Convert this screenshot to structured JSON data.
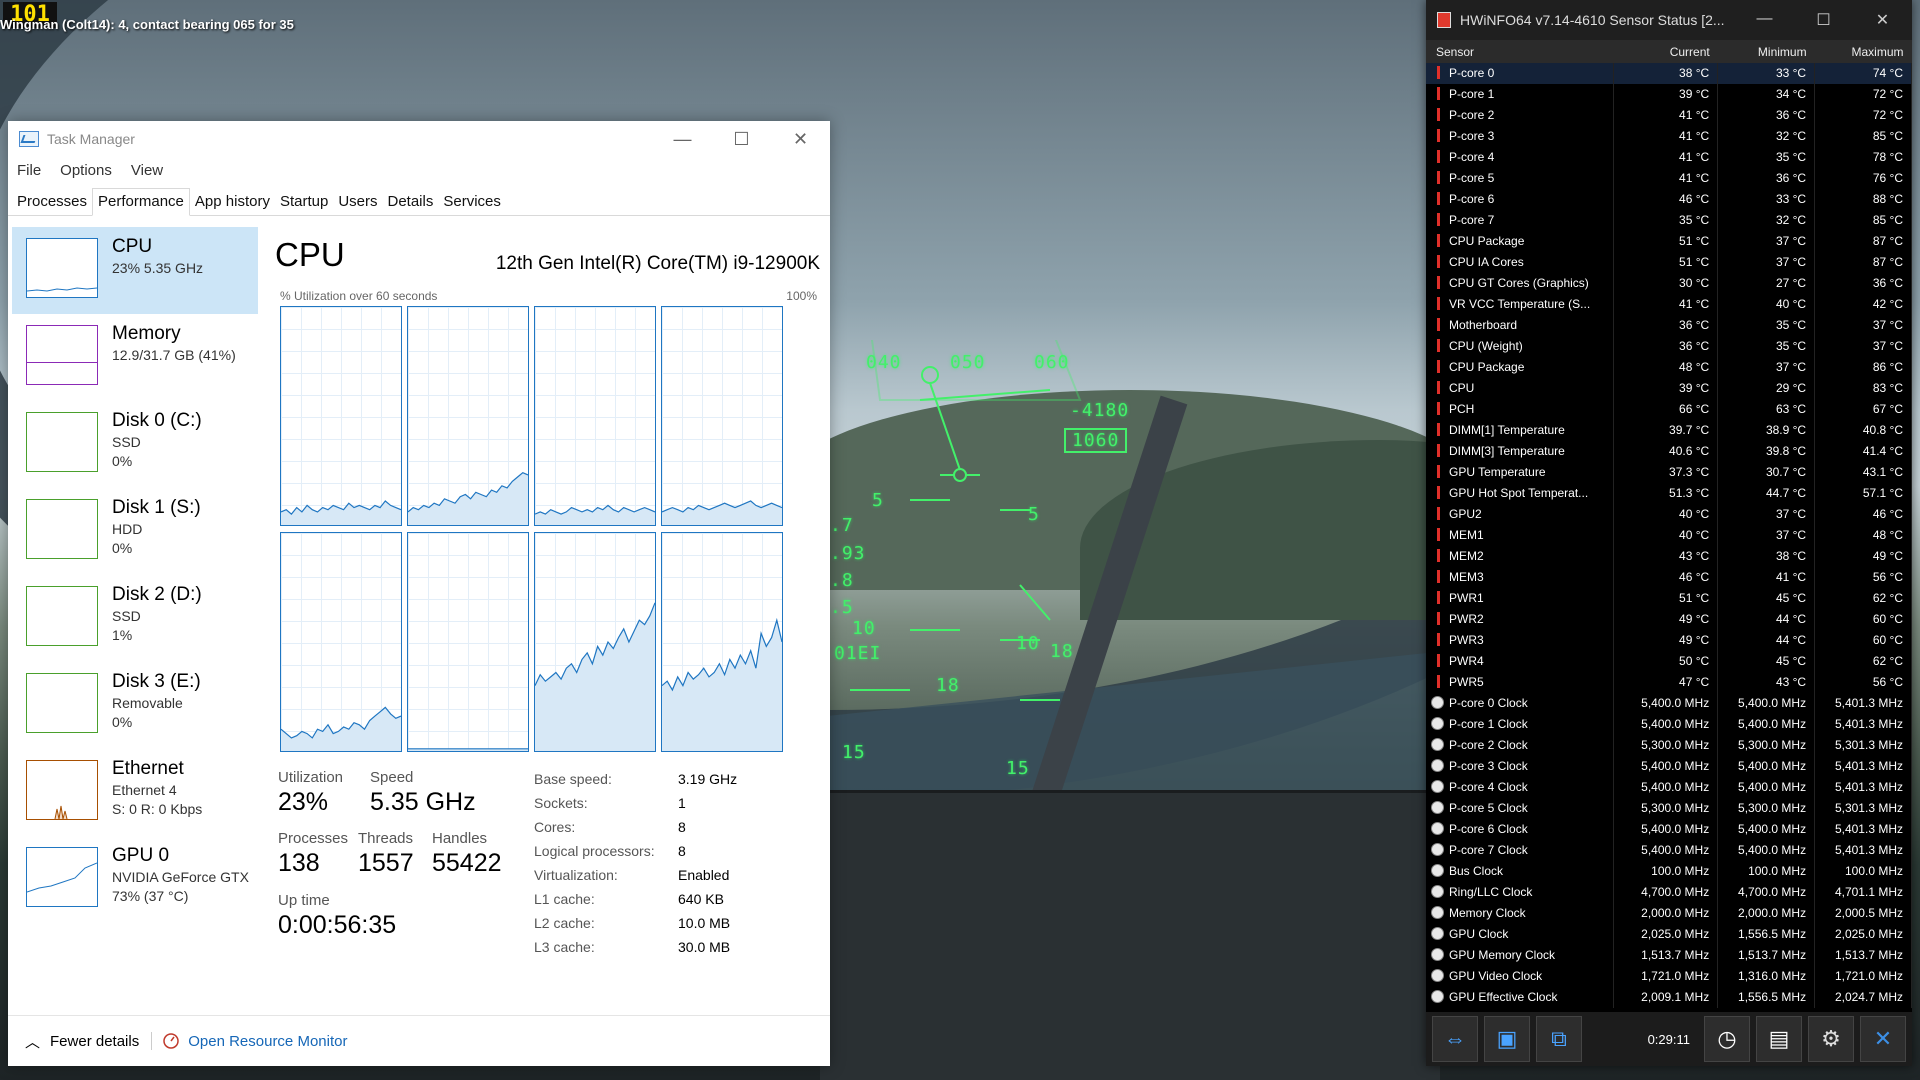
{
  "game": {
    "logo_text": "101",
    "status_line": "Wingman (Colt14): 4, contact bearing 065 for 35",
    "hud_labels": [
      "040",
      "050",
      "060",
      "-4180",
      "1060",
      "5",
      "5",
      ".7",
      ".93",
      ".8",
      ".5",
      "10",
      "10",
      "18",
      "18",
      "15",
      "15",
      "01EI"
    ]
  },
  "taskmanager": {
    "title": "Task Manager",
    "window_buttons": [
      "—",
      "☐",
      "✕"
    ],
    "menu": [
      "File",
      "Options",
      "View"
    ],
    "tabs": [
      "Processes",
      "Performance",
      "App history",
      "Startup",
      "Users",
      "Details",
      "Services"
    ],
    "active_tab": "Performance",
    "sidebar": [
      {
        "name": "CPU",
        "sub1": "23%  5.35 GHz",
        "sub2": ""
      },
      {
        "name": "Memory",
        "sub1": "12.9/31.7 GB (41%)",
        "sub2": ""
      },
      {
        "name": "Disk 0 (C:)",
        "sub1": "SSD",
        "sub2": "0%"
      },
      {
        "name": "Disk 1 (S:)",
        "sub1": "HDD",
        "sub2": "0%"
      },
      {
        "name": "Disk 2 (D:)",
        "sub1": "SSD",
        "sub2": "1%"
      },
      {
        "name": "Disk 3 (E:)",
        "sub1": "Removable",
        "sub2": "0%"
      },
      {
        "name": "Ethernet",
        "sub1": "Ethernet 4",
        "sub2": "S: 0 R: 0 Kbps"
      },
      {
        "name": "GPU 0",
        "sub1": "NVIDIA GeForce GTX",
        "sub2": "73% (37 °C)"
      }
    ],
    "cpu": {
      "heading": "CPU",
      "model": "12th Gen Intel(R) Core(TM) i9-12900K",
      "util_label": "% Utilization over 60 seconds",
      "util_max": "100%",
      "core_utilization": [
        [
          6,
          7,
          5,
          8,
          6,
          9,
          7,
          6,
          8,
          7,
          9,
          8,
          7,
          10,
          8,
          9,
          8,
          7,
          9,
          8,
          11,
          9,
          8,
          7
        ],
        [
          6,
          8,
          7,
          9,
          8,
          10,
          9,
          12,
          11,
          10,
          13,
          14,
          12,
          15,
          14,
          13,
          16,
          15,
          18,
          17,
          20,
          22,
          24,
          23
        ],
        [
          5,
          6,
          5,
          7,
          6,
          5,
          6,
          8,
          7,
          6,
          7,
          6,
          8,
          7,
          9,
          7,
          6,
          8,
          7,
          6,
          7,
          8,
          7,
          6
        ],
        [
          6,
          7,
          8,
          7,
          6,
          8,
          7,
          9,
          8,
          7,
          8,
          9,
          10,
          9,
          8,
          9,
          10,
          11,
          9,
          8,
          9,
          10,
          9,
          8
        ],
        [
          10,
          8,
          6,
          7,
          9,
          8,
          6,
          10,
          9,
          12,
          8,
          9,
          11,
          10,
          13,
          12,
          10,
          14,
          16,
          18,
          20,
          17,
          15,
          16
        ],
        [
          1,
          1,
          1,
          1,
          1,
          1,
          1,
          1,
          1,
          1,
          1,
          1,
          1,
          1,
          1,
          1,
          1,
          1,
          1,
          1,
          1,
          1,
          1,
          1
        ],
        [
          30,
          35,
          32,
          34,
          36,
          33,
          38,
          40,
          36,
          42,
          45,
          40,
          48,
          44,
          50,
          47,
          52,
          56,
          50,
          55,
          60,
          58,
          62,
          68
        ],
        [
          30,
          32,
          28,
          34,
          30,
          36,
          33,
          35,
          38,
          34,
          36,
          40,
          35,
          42,
          38,
          44,
          40,
          46,
          38,
          54,
          48,
          52,
          60,
          50
        ]
      ],
      "stats": {
        "utilization_label": "Utilization",
        "utilization": "23%",
        "speed_label": "Speed",
        "speed": "5.35 GHz",
        "processes_label": "Processes",
        "processes": "138",
        "threads_label": "Threads",
        "threads": "1557",
        "handles_label": "Handles",
        "handles": "55422",
        "uptime_label": "Up time",
        "uptime": "0:00:56:35"
      },
      "details": [
        {
          "k": "Base speed:",
          "v": "3.19 GHz"
        },
        {
          "k": "Sockets:",
          "v": "1"
        },
        {
          "k": "Cores:",
          "v": "8"
        },
        {
          "k": "Logical processors:",
          "v": "8"
        },
        {
          "k": "Virtualization:",
          "v": "Enabled"
        },
        {
          "k": "L1 cache:",
          "v": "640 KB"
        },
        {
          "k": "L2 cache:",
          "v": "10.0 MB"
        },
        {
          "k": "L3 cache:",
          "v": "30.0 MB"
        }
      ]
    },
    "footer": {
      "fewer": "Fewer details",
      "resource_monitor": "Open Resource Monitor"
    }
  },
  "hwinfo": {
    "title": "HWiNFO64 v7.14-4610 Sensor Status [2...",
    "window_buttons": [
      "—",
      "☐",
      "✕"
    ],
    "columns": [
      "Sensor",
      "Current",
      "Minimum",
      "Maximum"
    ],
    "rows": [
      [
        "P-core 0",
        "38 °C",
        "33 °C",
        "74 °C",
        "t"
      ],
      [
        "P-core 1",
        "39 °C",
        "34 °C",
        "72 °C",
        "t"
      ],
      [
        "P-core 2",
        "41 °C",
        "36 °C",
        "72 °C",
        "t"
      ],
      [
        "P-core 3",
        "41 °C",
        "32 °C",
        "85 °C",
        "t"
      ],
      [
        "P-core 4",
        "41 °C",
        "35 °C",
        "78 °C",
        "t"
      ],
      [
        "P-core 5",
        "41 °C",
        "36 °C",
        "76 °C",
        "t"
      ],
      [
        "P-core 6",
        "46 °C",
        "33 °C",
        "88 °C",
        "t"
      ],
      [
        "P-core 7",
        "35 °C",
        "32 °C",
        "85 °C",
        "t"
      ],
      [
        "CPU Package",
        "51 °C",
        "37 °C",
        "87 °C",
        "t"
      ],
      [
        "CPU IA Cores",
        "51 °C",
        "37 °C",
        "87 °C",
        "t"
      ],
      [
        "CPU GT Cores (Graphics)",
        "30 °C",
        "27 °C",
        "36 °C",
        "t"
      ],
      [
        "VR VCC Temperature (S...",
        "41 °C",
        "40 °C",
        "42 °C",
        "t"
      ],
      [
        "Motherboard",
        "36 °C",
        "35 °C",
        "37 °C",
        "t"
      ],
      [
        "CPU (Weight)",
        "36 °C",
        "35 °C",
        "37 °C",
        "t"
      ],
      [
        "CPU Package",
        "48 °C",
        "37 °C",
        "86 °C",
        "t"
      ],
      [
        "CPU",
        "39 °C",
        "29 °C",
        "83 °C",
        "t"
      ],
      [
        "PCH",
        "66 °C",
        "63 °C",
        "67 °C",
        "t"
      ],
      [
        "DIMM[1] Temperature",
        "39.7 °C",
        "38.9 °C",
        "40.8 °C",
        "t"
      ],
      [
        "DIMM[3] Temperature",
        "40.6 °C",
        "39.8 °C",
        "41.4 °C",
        "t"
      ],
      [
        "GPU Temperature",
        "37.3 °C",
        "30.7 °C",
        "43.1 °C",
        "t"
      ],
      [
        "GPU Hot Spot Temperat...",
        "51.3 °C",
        "44.7 °C",
        "57.1 °C",
        "t"
      ],
      [
        "GPU2",
        "40 °C",
        "37 °C",
        "46 °C",
        "t"
      ],
      [
        "MEM1",
        "40 °C",
        "37 °C",
        "48 °C",
        "t"
      ],
      [
        "MEM2",
        "43 °C",
        "38 °C",
        "49 °C",
        "t"
      ],
      [
        "MEM3",
        "46 °C",
        "41 °C",
        "56 °C",
        "t"
      ],
      [
        "PWR1",
        "51 °C",
        "45 °C",
        "62 °C",
        "t"
      ],
      [
        "PWR2",
        "49 °C",
        "44 °C",
        "60 °C",
        "t"
      ],
      [
        "PWR3",
        "49 °C",
        "44 °C",
        "60 °C",
        "t"
      ],
      [
        "PWR4",
        "50 °C",
        "45 °C",
        "62 °C",
        "t"
      ],
      [
        "PWR5",
        "47 °C",
        "43 °C",
        "56 °C",
        "t"
      ],
      [
        "P-core 0 Clock",
        "5,400.0 MHz",
        "5,400.0 MHz",
        "5,401.3 MHz",
        "c"
      ],
      [
        "P-core 1 Clock",
        "5,400.0 MHz",
        "5,400.0 MHz",
        "5,401.3 MHz",
        "c"
      ],
      [
        "P-core 2 Clock",
        "5,300.0 MHz",
        "5,300.0 MHz",
        "5,301.3 MHz",
        "c"
      ],
      [
        "P-core 3 Clock",
        "5,400.0 MHz",
        "5,400.0 MHz",
        "5,401.3 MHz",
        "c"
      ],
      [
        "P-core 4 Clock",
        "5,400.0 MHz",
        "5,400.0 MHz",
        "5,401.3 MHz",
        "c"
      ],
      [
        "P-core 5 Clock",
        "5,300.0 MHz",
        "5,300.0 MHz",
        "5,301.3 MHz",
        "c"
      ],
      [
        "P-core 6 Clock",
        "5,400.0 MHz",
        "5,400.0 MHz",
        "5,401.3 MHz",
        "c"
      ],
      [
        "P-core 7 Clock",
        "5,400.0 MHz",
        "5,400.0 MHz",
        "5,401.3 MHz",
        "c"
      ],
      [
        "Bus Clock",
        "100.0 MHz",
        "100.0 MHz",
        "100.0 MHz",
        "c"
      ],
      [
        "Ring/LLC Clock",
        "4,700.0 MHz",
        "4,700.0 MHz",
        "4,701.1 MHz",
        "c"
      ],
      [
        "Memory Clock",
        "2,000.0 MHz",
        "2,000.0 MHz",
        "2,000.5 MHz",
        "c"
      ],
      [
        "GPU Clock",
        "2,025.0 MHz",
        "1,556.5 MHz",
        "2,025.0 MHz",
        "c"
      ],
      [
        "GPU Memory Clock",
        "1,513.7 MHz",
        "1,513.7 MHz",
        "1,513.7 MHz",
        "c"
      ],
      [
        "GPU Video Clock",
        "1,721.0 MHz",
        "1,316.0 MHz",
        "1,721.0 MHz",
        "c"
      ],
      [
        "GPU Effective Clock",
        "2,009.1 MHz",
        "1,556.5 MHz",
        "2,024.7 MHz",
        "c"
      ]
    ],
    "toolbar": {
      "timer": "0:29:11",
      "icons": [
        "nav-arrows-icon",
        "network-monitor-icon",
        "network-icon",
        "clock-icon",
        "report-icon",
        "settings-icon",
        "close-icon"
      ]
    }
  }
}
